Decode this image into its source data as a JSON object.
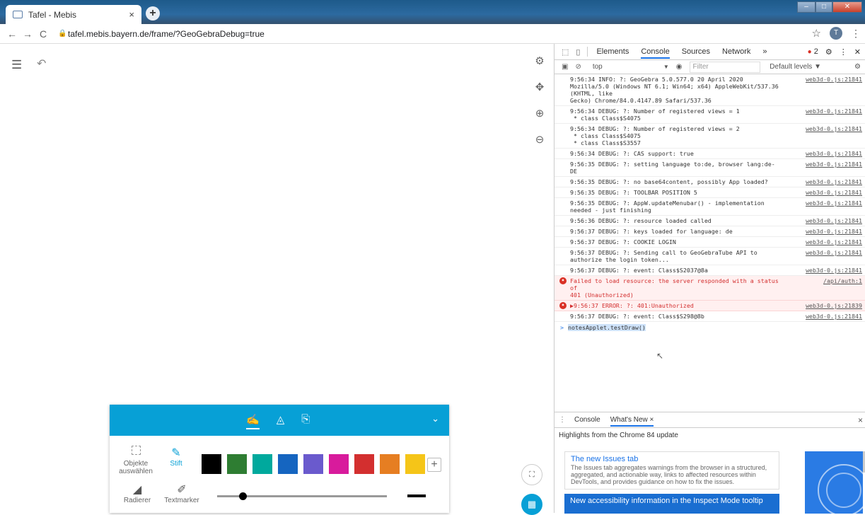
{
  "browser": {
    "tab_title": "Tafel - Mebis",
    "tab_close": "×",
    "new_tab": "+",
    "url": "tafel.mebis.bayern.de/frame/?GeoGebraDebug=true",
    "profile_initial": "T"
  },
  "app": {
    "toolbox": {
      "tools": {
        "select_label": "Objekte auswählen",
        "pen_label": "Stift",
        "eraser_label": "Radierer",
        "marker_label": "Textmarker"
      },
      "swatch_colors": [
        "#000000",
        "#2e7d32",
        "#00a99d",
        "#1565c0",
        "#6a5acd",
        "#d81b9c",
        "#d32f2f",
        "#e67e22",
        "#f5c518"
      ],
      "pen_size_value": 0.15
    }
  },
  "devtools": {
    "tabs": [
      "Elements",
      "Console",
      "Sources",
      "Network"
    ],
    "more_tabs": "»",
    "error_count": "2",
    "context": "top",
    "filter_placeholder": "Filter",
    "levels": "Default levels ▼",
    "log": [
      {
        "msg": "9:56:34 INFO: ?: GeoGebra 5.0.577.0 20 April 2020\nMozilla/5.0 (Windows NT 6.1; Win64; x64) AppleWebKit/537.36 (KHTML, like\nGecko) Chrome/84.0.4147.89 Safari/537.36",
        "src": "web3d-0.js:21841",
        "level": "info"
      },
      {
        "msg": "9:56:34 DEBUG: ?: Number of registered views = 1\n * class Class$S4075",
        "src": "web3d-0.js:21841",
        "level": "info"
      },
      {
        "msg": "9:56:34 DEBUG: ?: Number of registered views = 2\n * class Class$S4075\n * class Class$S3557",
        "src": "web3d-0.js:21841",
        "level": "info"
      },
      {
        "msg": "9:56:34 DEBUG: ?: CAS support: true",
        "src": "web3d-0.js:21841",
        "level": "info"
      },
      {
        "msg": "9:56:35 DEBUG: ?: setting language to:de, browser lang:de-\nDE",
        "src": "web3d-0.js:21841",
        "level": "info"
      },
      {
        "msg": "9:56:35 DEBUG: ?: no base64content, possibly App loaded?",
        "src": "web3d-0.js:21841",
        "level": "info"
      },
      {
        "msg": "9:56:35 DEBUG: ?: TOOLBAR POSITION 5",
        "src": "web3d-0.js:21841",
        "level": "info"
      },
      {
        "msg": "9:56:35 DEBUG: ?: AppW.updateMenubar() - implementation\nneeded - just finishing",
        "src": "web3d-0.js:21841",
        "level": "info"
      },
      {
        "msg": "9:56:36 DEBUG: ?: resource loaded called",
        "src": "web3d-0.js:21841",
        "level": "info"
      },
      {
        "msg": "9:56:37 DEBUG: ?: keys loaded for language: de",
        "src": "web3d-0.js:21841",
        "level": "info"
      },
      {
        "msg": "9:56:37 DEBUG: ?: COOKIE LOGIN",
        "src": "web3d-0.js:21841",
        "level": "info"
      },
      {
        "msg": "9:56:37 DEBUG: ?: Sending call to GeoGebraTube API to\nauthorize the login token...",
        "src": "web3d-0.js:21841",
        "level": "info"
      },
      {
        "msg": "9:56:37 DEBUG: ?: event: Class$S2037@8a",
        "src": "web3d-0.js:21841",
        "level": "info"
      },
      {
        "msg": "Failed to load resource: the server responded with a status of\n401 (Unauthorized)",
        "src": "/api/auth:1",
        "level": "error"
      },
      {
        "msg": "▶9:56:37 ERROR: ?: 401:Unauthorized",
        "src": "web3d-0.js:21839",
        "level": "error"
      },
      {
        "msg": "9:56:37 DEBUG: ?: event: Class$S298@8b",
        "src": "web3d-0.js:21841",
        "level": "info"
      }
    ],
    "prompt_symbol": ">",
    "command": "notesApplet.testDraw()",
    "drawer": {
      "tabs": [
        "Console",
        "What's New ×"
      ],
      "highlights": "Highlights from the Chrome 84 update",
      "card1_title": "The new Issues tab",
      "card1_desc": "The Issues tab aggregates warnings from the browser in a structured, aggregated, and actionable way, links to affected resources within DevTools, and provides guidance on how to fix the issues.",
      "card2_title": "New accessibility information in the Inspect Mode tooltip",
      "close": "×"
    }
  }
}
